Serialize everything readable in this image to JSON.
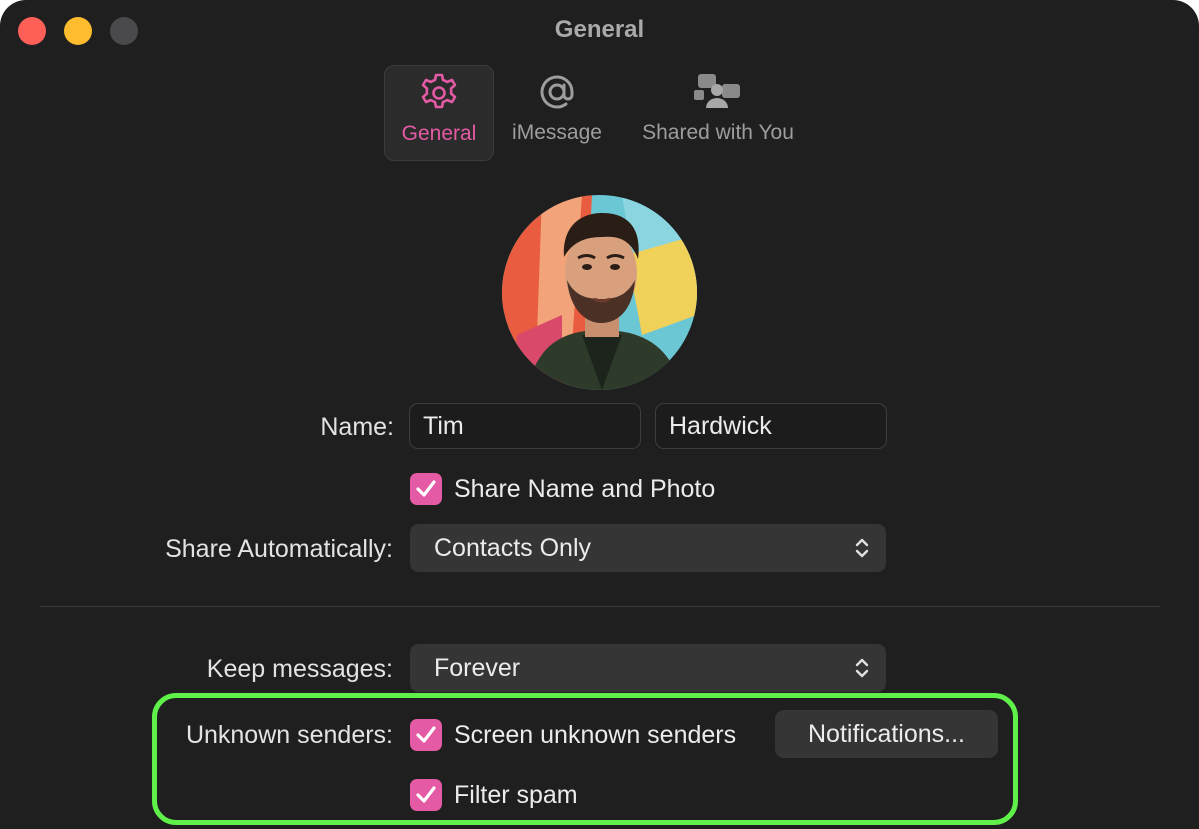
{
  "window": {
    "title": "General"
  },
  "tabs": [
    {
      "label": "General",
      "icon": "gear-icon",
      "selected": true
    },
    {
      "label": "iMessage",
      "icon": "at-sign-icon",
      "selected": false
    },
    {
      "label": "Shared with You",
      "icon": "shared-people-icon",
      "selected": false
    }
  ],
  "profile": {
    "name_label": "Name:",
    "first_name": "Tim",
    "last_name": "Hardwick",
    "share_name_photo_label": "Share Name and Photo",
    "share_name_photo_checked": true,
    "share_auto_label": "Share Automatically:",
    "share_auto_value": "Contacts Only"
  },
  "messages": {
    "keep_label": "Keep messages:",
    "keep_value": "Forever",
    "unknown_label": "Unknown senders:",
    "screen_unknown_label": "Screen unknown senders",
    "screen_unknown_checked": true,
    "notifications_button": "Notifications...",
    "filter_spam_label": "Filter spam",
    "filter_spam_checked": true
  },
  "colors": {
    "accent": "#e45aa4",
    "highlight": "#5ff04a",
    "window_bg": "#1f1f1f"
  }
}
